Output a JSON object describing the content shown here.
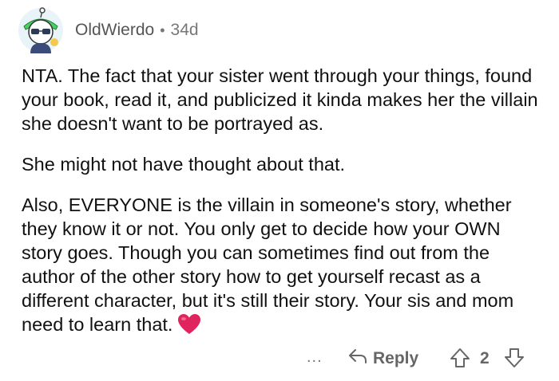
{
  "comment": {
    "username": "OldWierdo",
    "separator": "•",
    "age": "34d",
    "paragraphs": [
      "NTA. The fact that your sister went through your things, found your book, read it, and publicized it kinda makes her the villain she doesn't want to be portrayed as.",
      "She might not have thought about that.",
      "Also, EVERYONE is the villain in someone's story, whether they know it or not. You only get to decide how your OWN story goes. Though you can sometimes find out from the author of the other story how to get yourself recast as a different character, but it's still their story. Your sis and mom need to learn that."
    ],
    "trailing_emoji": "heart-emoji"
  },
  "actions": {
    "more": "...",
    "reply_label": "Reply",
    "score": "2"
  },
  "colors": {
    "text": "#1a1a1b",
    "meta": "#777777",
    "heart": "#e0245e",
    "avatar_green": "#46d160"
  }
}
